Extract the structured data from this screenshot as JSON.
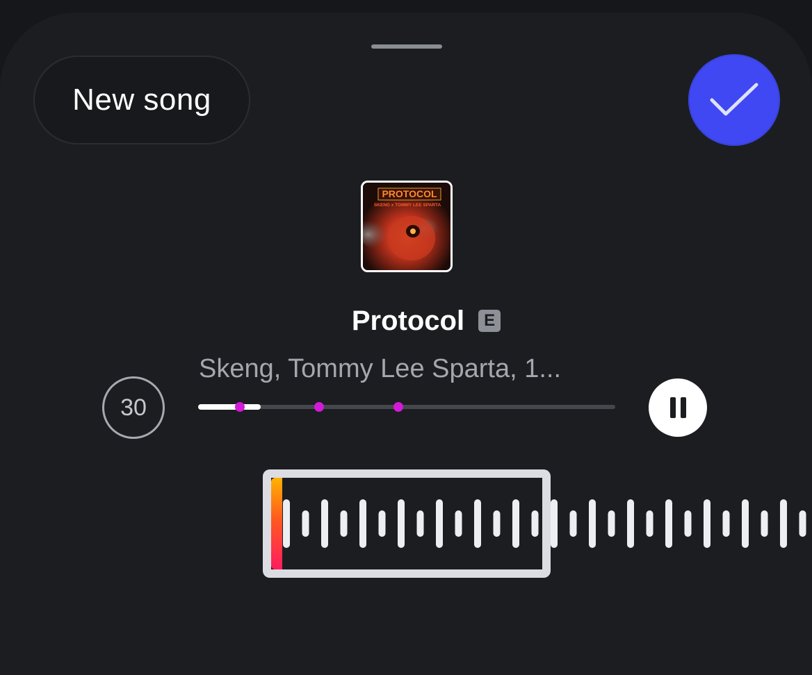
{
  "header": {
    "new_song_label": "New song",
    "confirm_icon": "checkmark-icon"
  },
  "colors": {
    "accent": "#3f48f2",
    "marker": "#d11bd6",
    "sheet_background": "#1c1d21"
  },
  "track": {
    "title": "Protocol",
    "explicit_badge": "E",
    "artists": "Skeng, Tommy Lee Sparta, 1...",
    "cover_art_text": "PROTOCOL",
    "cover_art_subtext": "SKENG x TOMMY LEE SPARTA"
  },
  "player": {
    "clip_duration": "30",
    "progress_fraction": 0.15,
    "marker_fractions": [
      0.1,
      0.29,
      0.48
    ],
    "pause_icon": "pause-icon"
  },
  "waveform": {
    "selection_start_fraction": 0.0,
    "selection_bar_count": 13
  }
}
